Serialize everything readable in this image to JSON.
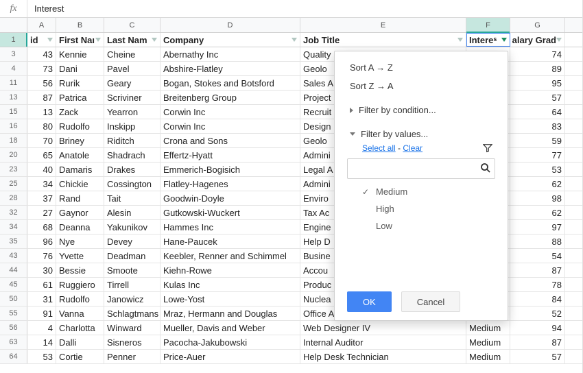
{
  "formula_bar": {
    "value": "Interest"
  },
  "columns": {
    "letters": [
      "A",
      "B",
      "C",
      "D",
      "E",
      "F",
      "G"
    ],
    "selected_index": 5,
    "headers": [
      "id",
      "First Naı",
      "Last Nam",
      "Company",
      "Job Title",
      "Intereˢ",
      "alary Grad"
    ]
  },
  "header_row_number": "1",
  "rows": [
    {
      "n": "3",
      "id": "43",
      "fn": "Kennie",
      "ln": "Cheine",
      "co": "Abernathy Inc",
      "jt": "Quality",
      "int": "",
      "sg": "74"
    },
    {
      "n": "4",
      "id": "73",
      "fn": "Dani",
      "ln": "Pavel",
      "co": "Abshire-Flatley",
      "jt": "Geolo",
      "int": "",
      "sg": "89"
    },
    {
      "n": "11",
      "id": "56",
      "fn": "Rurik",
      "ln": "Geary",
      "co": "Bogan, Stokes and Botsford",
      "jt": "Sales A",
      "int": "",
      "sg": "95"
    },
    {
      "n": "13",
      "id": "87",
      "fn": "Patrica",
      "ln": "Scriviner",
      "co": "Breitenberg Group",
      "jt": "Project",
      "int": "",
      "sg": "57"
    },
    {
      "n": "15",
      "id": "13",
      "fn": "Zack",
      "ln": "Yearron",
      "co": "Corwin Inc",
      "jt": "Recruit",
      "int": "",
      "sg": "64"
    },
    {
      "n": "16",
      "id": "80",
      "fn": "Rudolfo",
      "ln": "Inskipp",
      "co": "Corwin Inc",
      "jt": "Design",
      "int": "",
      "sg": "83"
    },
    {
      "n": "18",
      "id": "70",
      "fn": "Briney",
      "ln": "Riditch",
      "co": "Crona and Sons",
      "jt": "Geolo",
      "int": "",
      "sg": "59"
    },
    {
      "n": "20",
      "id": "65",
      "fn": "Anatole",
      "ln": "Shadrach",
      "co": "Effertz-Hyatt",
      "jt": "Admini",
      "int": "",
      "sg": "77"
    },
    {
      "n": "23",
      "id": "40",
      "fn": "Damaris",
      "ln": "Drakes",
      "co": "Emmerich-Bogisich",
      "jt": "Legal A",
      "int": "",
      "sg": "53"
    },
    {
      "n": "25",
      "id": "34",
      "fn": "Chickie",
      "ln": "Cossington",
      "co": "Flatley-Hagenes",
      "jt": "Admini",
      "int": "",
      "sg": "62"
    },
    {
      "n": "28",
      "id": "37",
      "fn": "Rand",
      "ln": "Tait",
      "co": "Goodwin-Doyle",
      "jt": "Enviro",
      "int": "",
      "sg": "98"
    },
    {
      "n": "32",
      "id": "27",
      "fn": "Gaynor",
      "ln": "Alesin",
      "co": "Gutkowski-Wuckert",
      "jt": "Tax Ac",
      "int": "",
      "sg": "62"
    },
    {
      "n": "34",
      "id": "68",
      "fn": "Deanna",
      "ln": "Yakunikov",
      "co": "Hammes Inc",
      "jt": "Engine",
      "int": "",
      "sg": "97"
    },
    {
      "n": "35",
      "id": "96",
      "fn": "Nye",
      "ln": "Devey",
      "co": "Hane-Paucek",
      "jt": "Help D",
      "int": "",
      "sg": "88"
    },
    {
      "n": "43",
      "id": "76",
      "fn": "Yvette",
      "ln": "Deadman",
      "co": "Keebler, Renner and Schimmel",
      "jt": "Busine",
      "int": "",
      "sg": "54"
    },
    {
      "n": "44",
      "id": "30",
      "fn": "Bessie",
      "ln": "Smoote",
      "co": "Kiehn-Rowe",
      "jt": "Accou",
      "int": "",
      "sg": "87"
    },
    {
      "n": "45",
      "id": "61",
      "fn": "Ruggiero",
      "ln": "Tirrell",
      "co": "Kulas Inc",
      "jt": "Produc",
      "int": "",
      "sg": "78"
    },
    {
      "n": "50",
      "id": "31",
      "fn": "Rudolfo",
      "ln": "Janowicz",
      "co": "Lowe-Yost",
      "jt": "Nuclea",
      "int": "",
      "sg": "84"
    },
    {
      "n": "55",
      "id": "91",
      "fn": "Vanna",
      "ln": "Schlagtmans",
      "co": "Mraz, Hermann and Douglas",
      "jt": "Office A",
      "int": "",
      "sg": "52"
    },
    {
      "n": "56",
      "id": "4",
      "fn": "Charlotta",
      "ln": "Winward",
      "co": "Mueller, Davis and Weber",
      "jt": "Web Designer IV",
      "int": "Medium",
      "sg": "94"
    },
    {
      "n": "63",
      "id": "14",
      "fn": "Dalli",
      "ln": "Sisneros",
      "co": "Pacocha-Jakubowski",
      "jt": "Internal Auditor",
      "int": "Medium",
      "sg": "87"
    },
    {
      "n": "64",
      "id": "53",
      "fn": "Cortie",
      "ln": "Penner",
      "co": "Price-Auer",
      "jt": "Help Desk Technician",
      "int": "Medium",
      "sg": "57"
    }
  ],
  "dropdown": {
    "sort_az": "Sort A → Z",
    "sort_za": "Sort Z → A",
    "filter_condition": "Filter by condition...",
    "filter_values": "Filter by values...",
    "select_all": "Select all",
    "sep": " - ",
    "clear": "Clear",
    "search_placeholder": "",
    "choices": [
      {
        "label": "Medium",
        "checked": true
      },
      {
        "label": "High",
        "checked": false
      },
      {
        "label": "Low",
        "checked": false
      }
    ],
    "ok": "OK",
    "cancel": "Cancel"
  }
}
